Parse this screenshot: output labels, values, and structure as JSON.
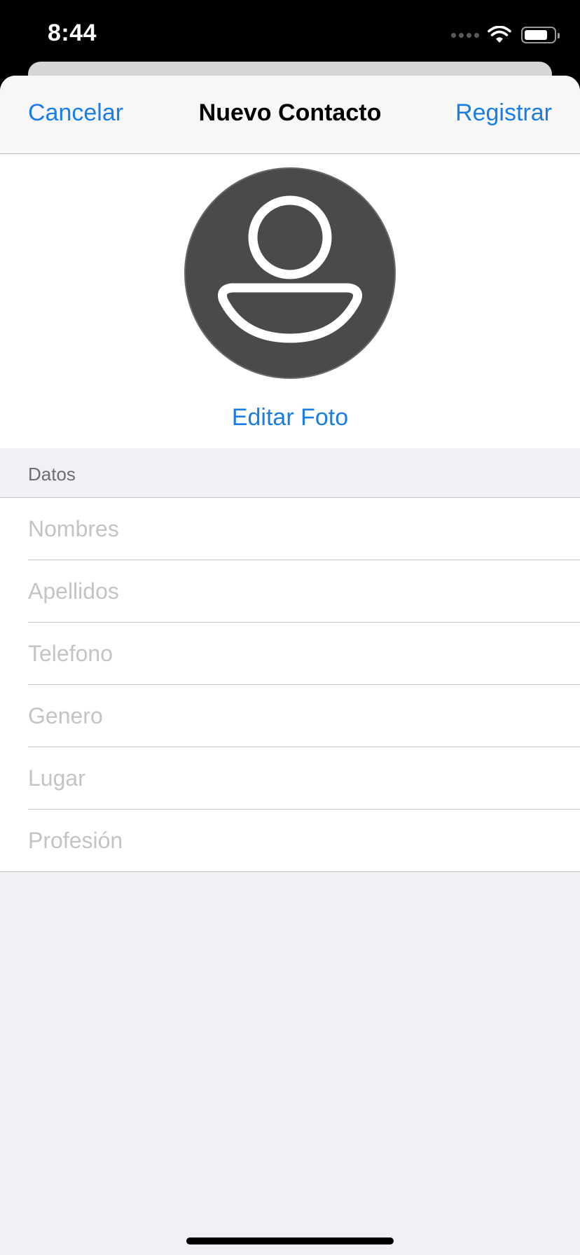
{
  "status_bar": {
    "time": "8:44",
    "icons": [
      "signal-dots-icon",
      "wifi-icon",
      "battery-icon"
    ],
    "battery_level": 0.8
  },
  "nav": {
    "cancel_label": "Cancelar",
    "title": "Nuevo Contacto",
    "register_label": "Registrar"
  },
  "photo": {
    "avatar_icon": "person-placeholder-icon",
    "edit_label": "Editar Foto"
  },
  "form": {
    "section_title": "Datos",
    "fields": [
      {
        "placeholder": "Nombres",
        "value": ""
      },
      {
        "placeholder": "Apellidos",
        "value": ""
      },
      {
        "placeholder": "Telefono",
        "value": ""
      },
      {
        "placeholder": "Genero",
        "value": ""
      },
      {
        "placeholder": "Lugar",
        "value": ""
      },
      {
        "placeholder": "Profesión",
        "value": ""
      }
    ]
  },
  "colors": {
    "accent": "#1a7ee6",
    "background": "#f0f0f5",
    "avatar_bg": "#4a4a4a",
    "placeholder": "#c4c4c7"
  }
}
